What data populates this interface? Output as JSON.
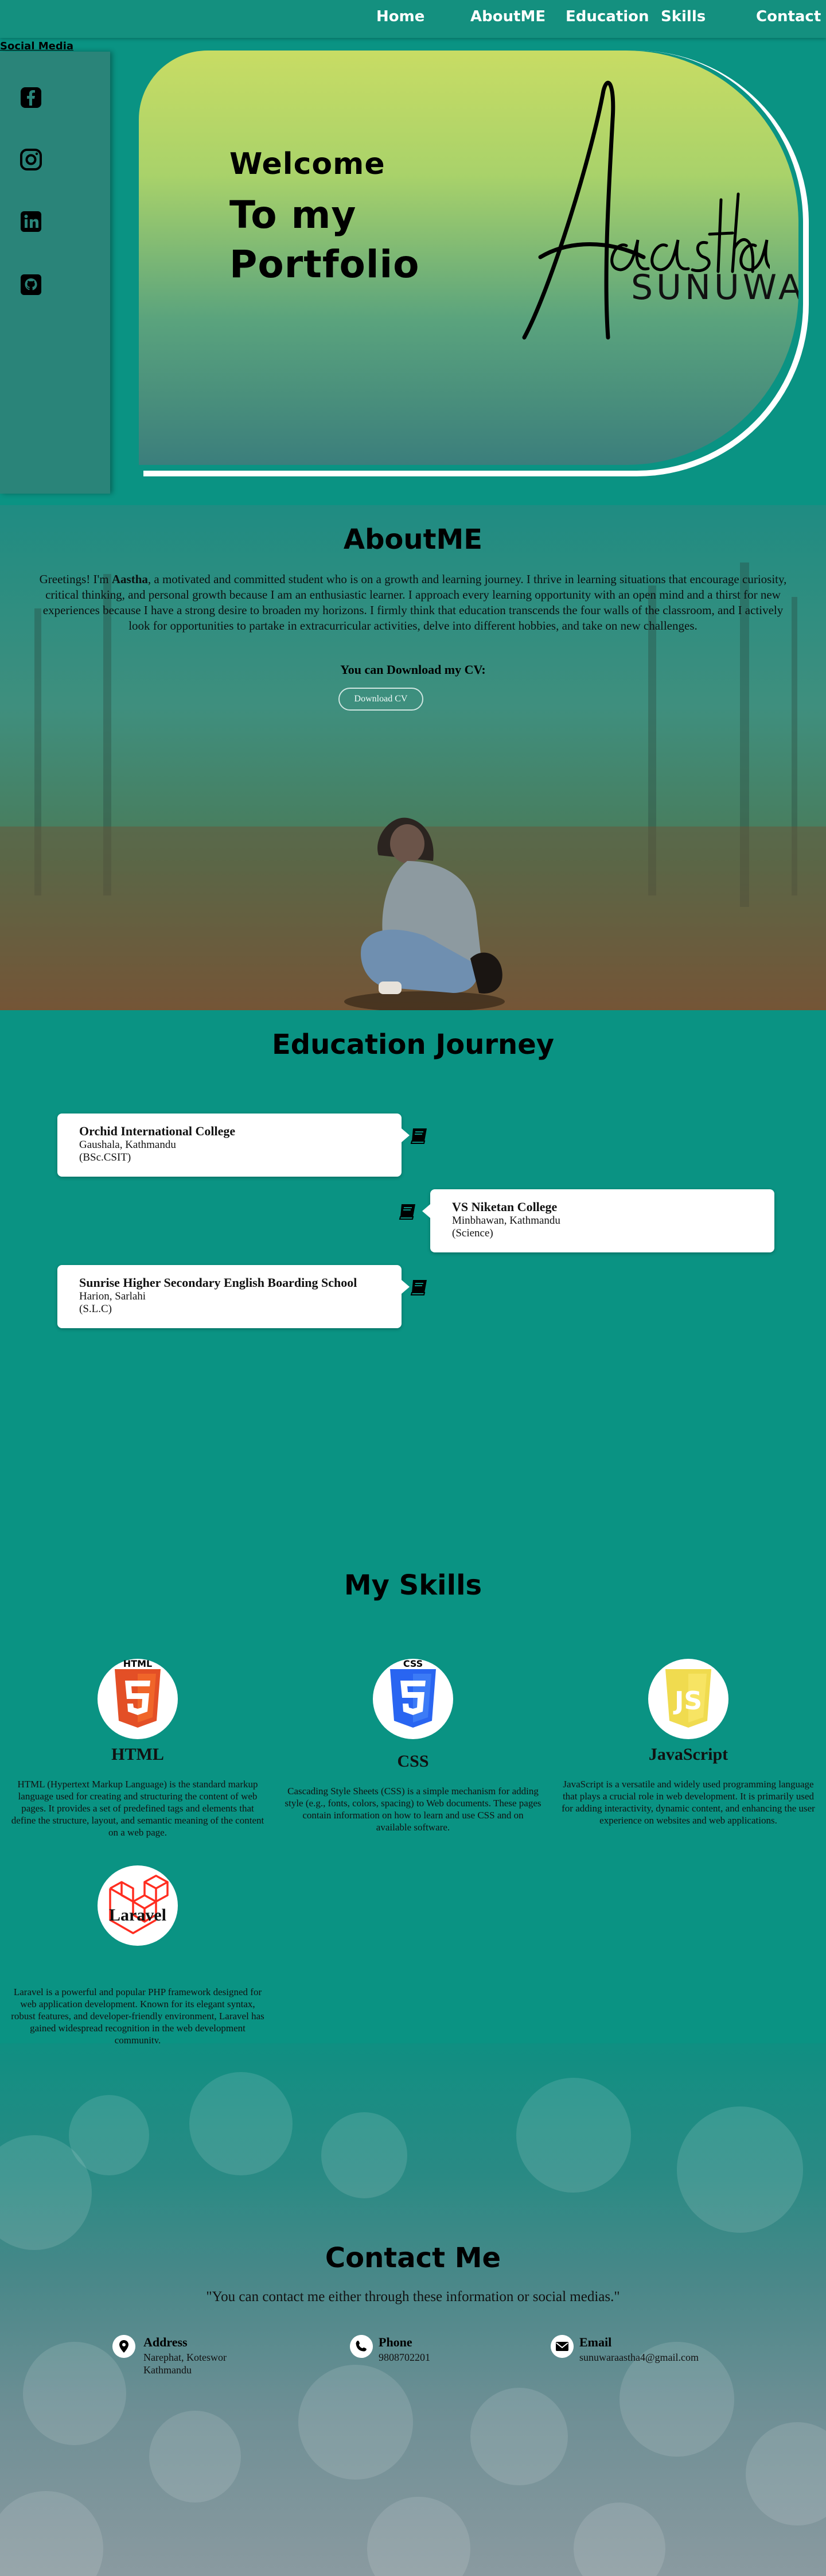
{
  "nav": {
    "items": [
      "Home",
      "AboutME",
      "Education",
      "Skills",
      "Contact"
    ]
  },
  "social": {
    "title": "Social Media",
    "icons": [
      "facebook-icon",
      "instagram-icon",
      "linkedin-icon",
      "github-icon"
    ]
  },
  "hero": {
    "line1": "Welcome",
    "line2": "To my",
    "line3": "Portfolio",
    "signature": "Aastha",
    "signature_sub": "SUNUWAR"
  },
  "about": {
    "title": "AboutME",
    "text_before": "Greetings! I'm ",
    "name": "Aastha",
    "text_after": ", a motivated and committed student who is on a growth and learning journey. I thrive in learning situations that encourage curiosity, critical thinking, and personal growth because I am an enthusiastic learner. I approach every learning opportunity with an open mind and a thirst for new experiences because I have a strong desire to broaden my horizons. I firmly think that education transcends the four walls of the classroom, and I actively look for opportunities to partake in extracurricular activities, delve into different hobbies, and take on new challenges.",
    "cv_text": "You can Download my CV:",
    "cv_button": "Download CV"
  },
  "education": {
    "title": "Education Journey",
    "items": [
      {
        "name": "Orchid International College",
        "location": "Gaushala, Kathmandu",
        "degree": "(BSc.CSIT)"
      },
      {
        "name": "VS Niketan College",
        "location": "Minbhawan, Kathmandu",
        "degree": "(Science)"
      },
      {
        "name": "Sunrise Higher Secondary English Boarding School",
        "location": "Harion, Sarlahi",
        "degree": "(S.L.C)"
      }
    ]
  },
  "skills": {
    "title": "My Skills",
    "items": [
      {
        "name": "HTML",
        "icon": "html5-icon",
        "desc": "HTML (Hypertext Markup Language) is the standard markup language used for creating and structuring the content of web pages. It provides a set of predefined tags and elements that define the structure, layout, and semantic meaning of the content on a web page."
      },
      {
        "name": "CSS",
        "icon": "css3-icon",
        "desc": "Cascading Style Sheets (CSS) is a simple mechanism for adding style (e.g., fonts, colors, spacing) to Web documents. These pages contain information on how to learn and use CSS and on available software."
      },
      {
        "name": "JavaScript",
        "icon": "javascript-icon",
        "desc": "JavaScript is a versatile and widely used programming language that plays a crucial role in web development. It is primarily used for adding interactivity, dynamic content, and enhancing the user experience on websites and web applications."
      },
      {
        "name": "Laravel",
        "icon": "laravel-icon",
        "desc": "Laravel is a powerful and popular PHP framework designed for web application development. Known for its elegant syntax, robust features, and developer-friendly environment, Laravel has gained widespread recognition in the web development community."
      }
    ]
  },
  "contact": {
    "title": "Contact Me",
    "quote": "\"You can contact me either through these information or social medias.\"",
    "items": [
      {
        "label": "Address",
        "lines": [
          "Narephat, Koteswor",
          "Kathmandu"
        ],
        "icon": "location-pin-icon"
      },
      {
        "label": "Phone",
        "lines": [
          "9808702201"
        ],
        "icon": "phone-icon"
      },
      {
        "label": "Email",
        "lines": [
          "sunuwaraastha4@gmail.com"
        ],
        "icon": "envelope-icon"
      }
    ]
  },
  "colors": {
    "background": "#0a9383",
    "navbar": "#14907f",
    "hero_top": "#c8dc64",
    "hero_bottom": "#3b7e7c",
    "html": "#e34f26",
    "css": "#2965f1",
    "js": "#f0db4f",
    "laravel": "#ff2d20"
  }
}
